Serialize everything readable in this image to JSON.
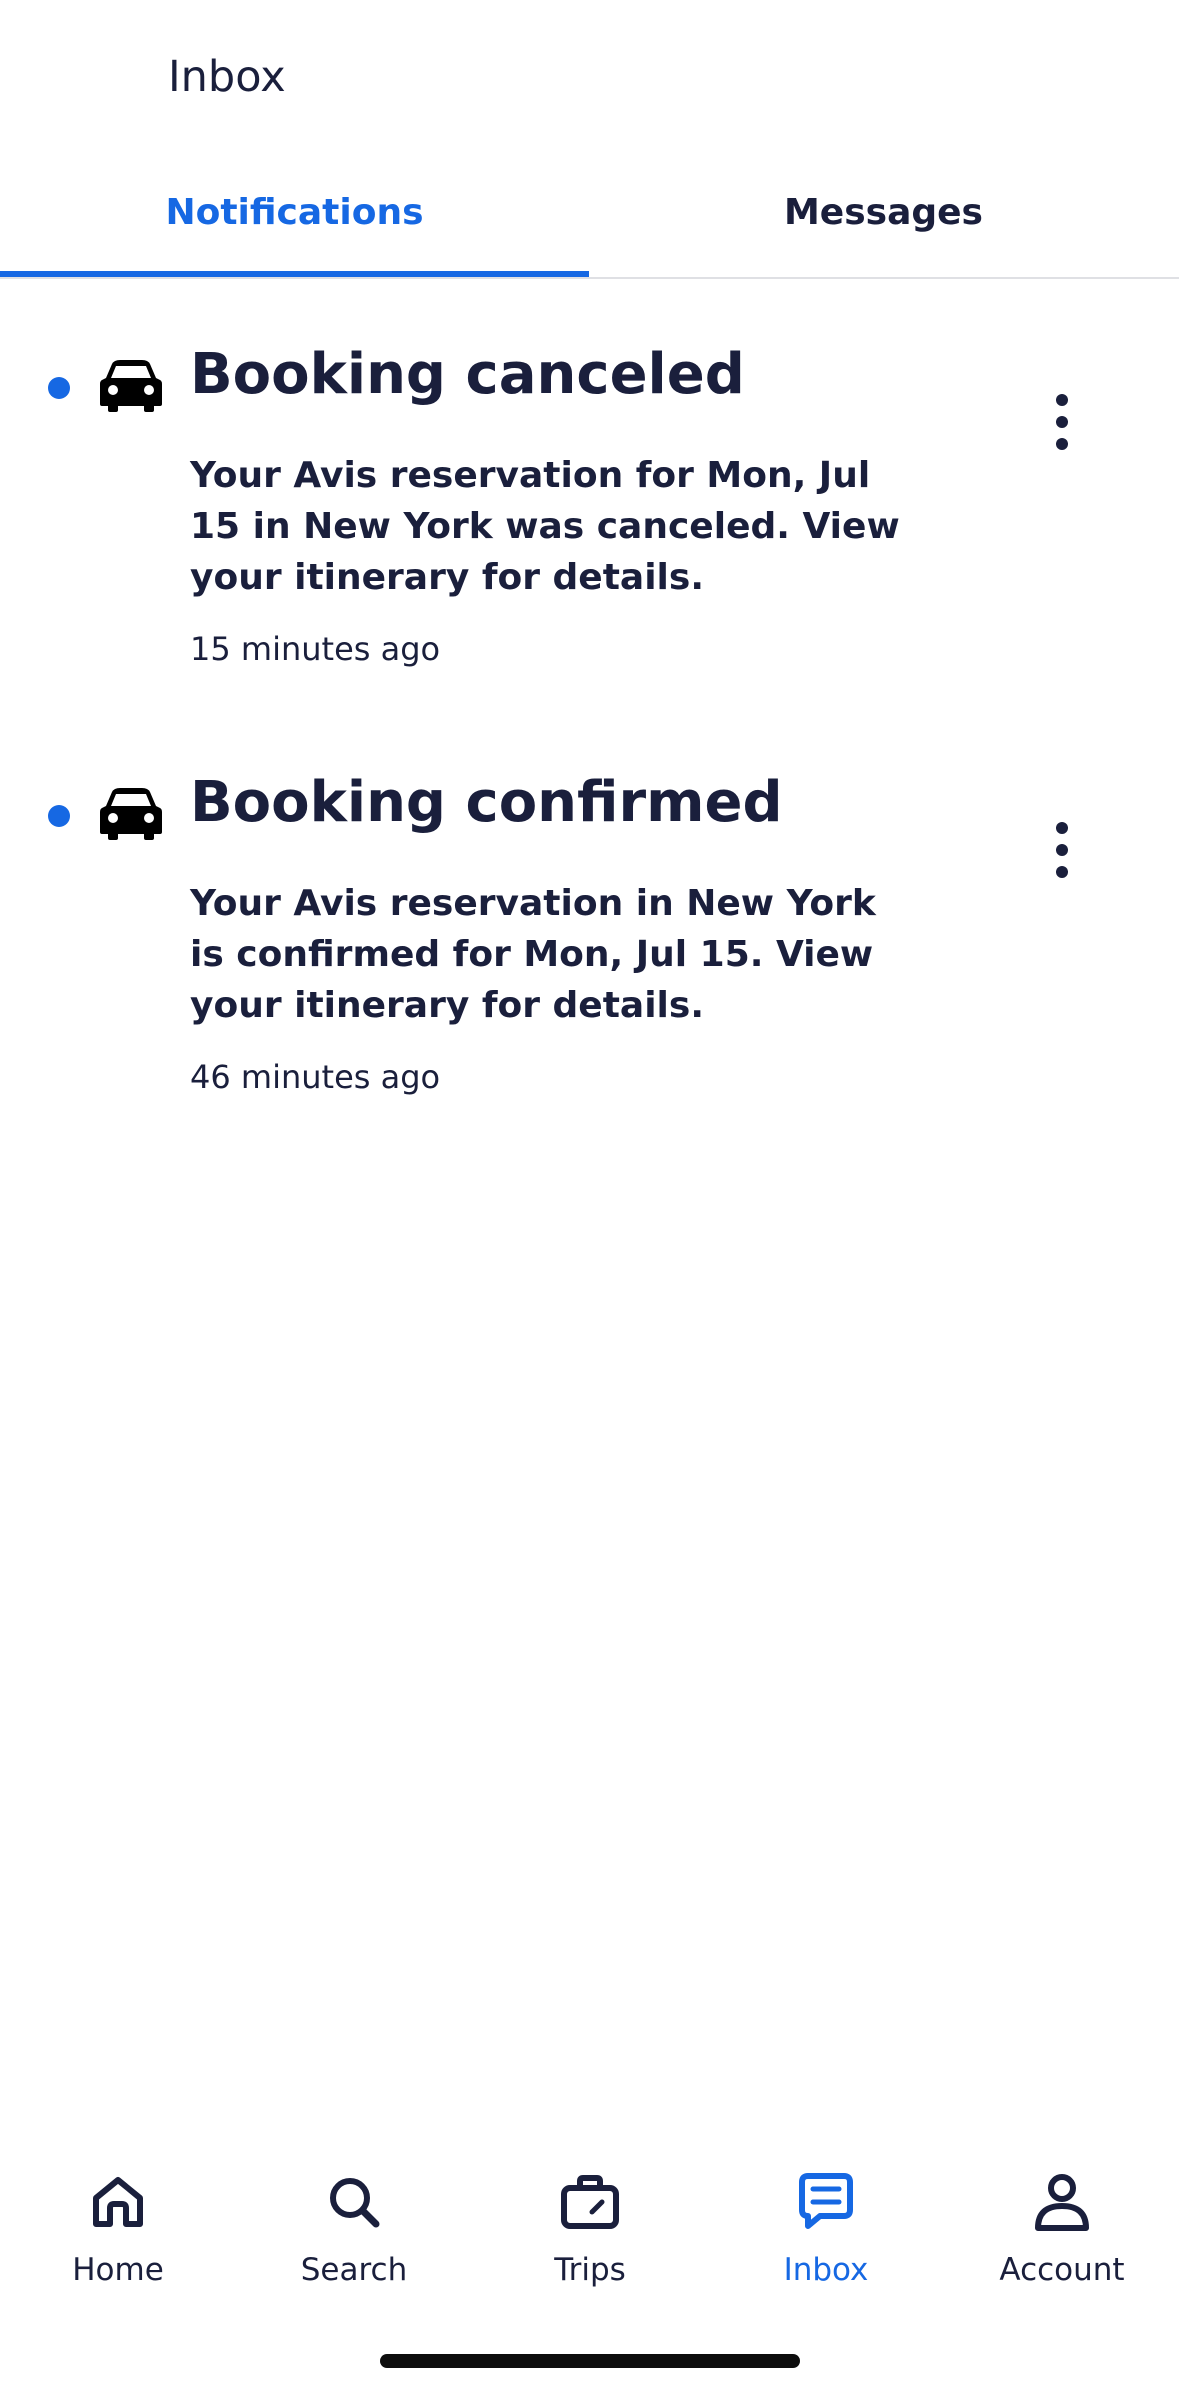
{
  "header": {
    "title": "Inbox"
  },
  "tabs": [
    {
      "label": "Notifications",
      "active": true
    },
    {
      "label": "Messages",
      "active": false
    }
  ],
  "notifications": [
    {
      "title": "Booking canceled",
      "body": "Your Avis reservation for Mon, Jul 15 in New York was canceled. View your itinerary for details.",
      "time": "15 minutes ago",
      "unread": true,
      "icon": "car-icon"
    },
    {
      "title": "Booking confirmed",
      "body": "Your Avis reservation in New York is confirmed for Mon, Jul 15. View your itinerary for details.",
      "time": "46 minutes ago",
      "unread": true,
      "icon": "car-icon"
    }
  ],
  "bottom_nav": [
    {
      "label": "Home",
      "icon": "home-icon",
      "active": false
    },
    {
      "label": "Search",
      "icon": "search-icon",
      "active": false
    },
    {
      "label": "Trips",
      "icon": "suitcase-icon",
      "active": false
    },
    {
      "label": "Inbox",
      "icon": "message-icon",
      "active": true
    },
    {
      "label": "Account",
      "icon": "person-icon",
      "active": false
    }
  ],
  "colors": {
    "accent": "#1668e3",
    "text": "#1a1f3c",
    "divider": "#dfe0e4"
  }
}
